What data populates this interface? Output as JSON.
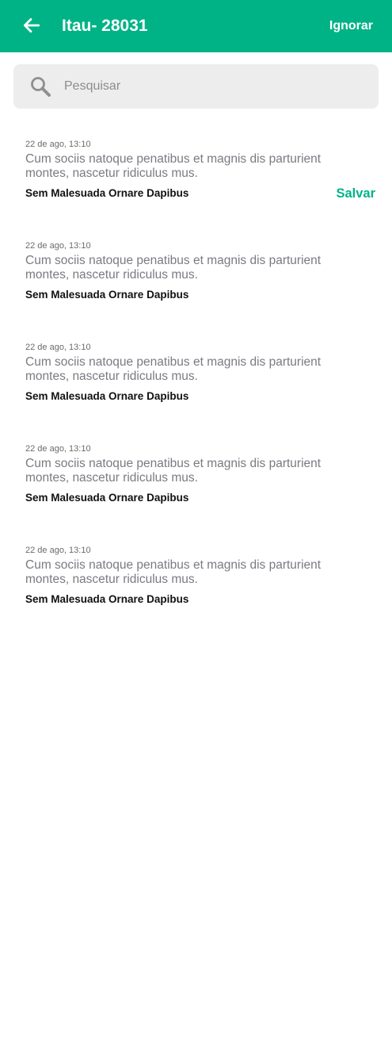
{
  "header": {
    "title": "Itau- 28031",
    "skip_label": "Ignorar",
    "back_icon": "arrow-left-icon"
  },
  "search": {
    "placeholder": "Pesquisar",
    "value": "",
    "icon": "search-icon"
  },
  "messages": [
    {
      "date": "22 de ago, 13:10",
      "text": "Cum sociis natoque penatibus et magnis dis parturient montes, nascetur ridiculus mus.",
      "sender": "Sem Malesuada Ornare Dapibus",
      "action": "Salvar"
    },
    {
      "date": "22 de ago, 13:10",
      "text": "Cum sociis natoque penatibus et magnis dis parturient montes, nascetur ridiculus mus.",
      "sender": "Sem Malesuada Ornare Dapibus"
    },
    {
      "date": "22 de ago, 13:10",
      "text": "Cum sociis natoque penatibus et magnis dis parturient montes, nascetur ridiculus mus.",
      "sender": "Sem Malesuada Ornare Dapibus"
    },
    {
      "date": "22 de ago, 13:10",
      "text": "Cum sociis natoque penatibus et magnis dis parturient montes, nascetur ridiculus mus.",
      "sender": "Sem Malesuada Ornare Dapibus"
    },
    {
      "date": "22 de ago, 13:10",
      "text": "Cum sociis natoque penatibus et magnis dis parturient montes, nascetur ridiculus mus.",
      "sender": "Sem Malesuada Ornare Dapibus"
    }
  ],
  "colors": {
    "accent": "#00b386",
    "search_background": "#ededed",
    "text_secondary": "#7a7a82",
    "text_primary": "#111111"
  }
}
